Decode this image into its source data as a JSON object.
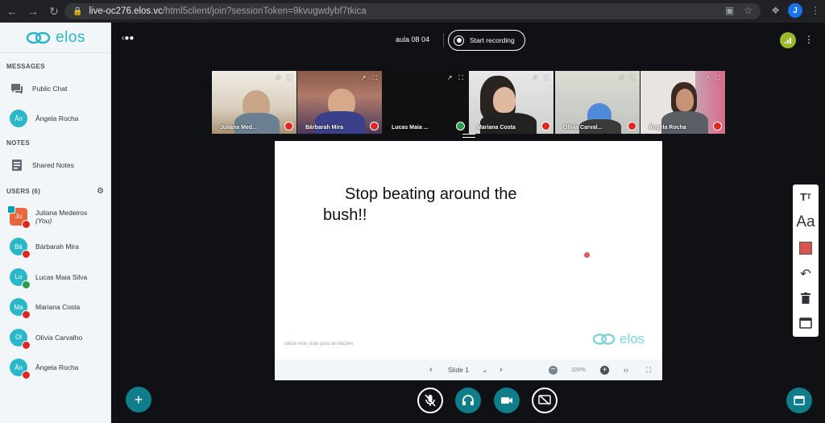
{
  "browser": {
    "url_host": "live-oc276.elos.vc",
    "url_path": "/html5client/join?sessionToken=9kvugwdybf7tkica",
    "profile_initial": "J"
  },
  "sidebar": {
    "logo_text": "elos",
    "messages_title": "MESSAGES",
    "public_chat": "Public Chat",
    "chat_user_initials": "Ân",
    "chat_user_name": "Ângela Rocha",
    "notes_title": "NOTES",
    "shared_notes": "Shared Notes",
    "users_title": "USERS (6)",
    "users": [
      {
        "initials": "Ju",
        "name": "Juliana Medeiros",
        "suffix": "(You)",
        "mic": "muted"
      },
      {
        "initials": "Bá",
        "name": "Bárbarah Mira",
        "mic": "muted"
      },
      {
        "initials": "Lu",
        "name": "Lucas Maia Silva",
        "mic": "listen"
      },
      {
        "initials": "Ma",
        "name": "Mariana Costa",
        "mic": "muted"
      },
      {
        "initials": "Ol",
        "name": "Olívia Carvalho",
        "mic": "muted"
      },
      {
        "initials": "Ân",
        "name": "Ângela Rocha",
        "mic": "muted"
      }
    ]
  },
  "topbar": {
    "meeting_title": "aula 08 04",
    "record_label": "Start recording"
  },
  "videos": [
    {
      "label": "Juliana Med...",
      "mic": "muted"
    },
    {
      "label": "Bárbarah Mira",
      "mic": "muted"
    },
    {
      "label": "Lucas Maia ...",
      "mic": "listen"
    },
    {
      "label": "Mariana Costa",
      "mic": "muted"
    },
    {
      "label": "Olívia Carval...",
      "mic": "muted"
    },
    {
      "label": "Ângela Rocha",
      "mic": "muted"
    }
  ],
  "slide": {
    "text_line1": "Stop beating around the",
    "text_line2": "bush!!",
    "note": "utilize este slide para anotações",
    "logo_text": "elos",
    "current": "Slide 1",
    "zoom": "100%"
  },
  "colors": {
    "accent": "#2ab7c9",
    "action": "#0f7d8a",
    "muted": "#df2721",
    "background": "#0f1115"
  }
}
